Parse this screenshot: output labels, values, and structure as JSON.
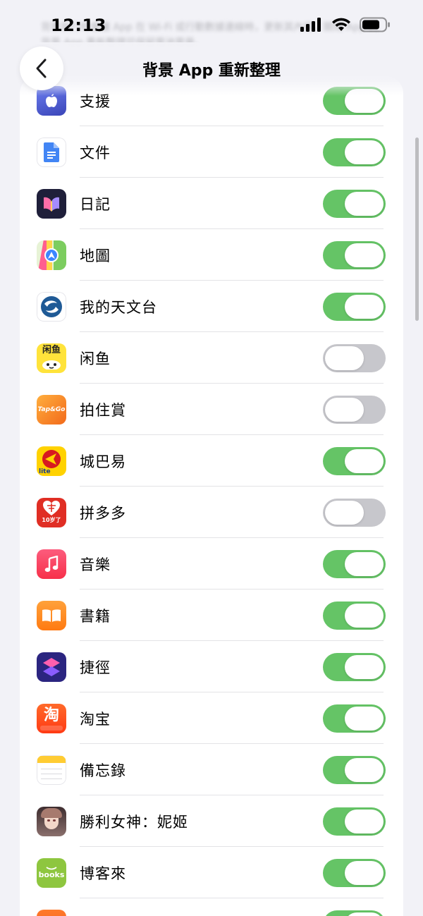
{
  "status": {
    "time": "12:13"
  },
  "nav": {
    "title": "背景 App 重新整理"
  },
  "header_hint": "背景執行時會讓 App 在 Wi-Fi 或行動數據連線時，更新其內容。關閉 App 的背景 App 重新整理可保留電池電量。",
  "apps": [
    {
      "name": "支援",
      "on": true,
      "icon": "apple-support-icon",
      "color": "#4a5bd6"
    },
    {
      "name": "文件",
      "on": true,
      "icon": "google-docs-icon",
      "color": "#ffffff"
    },
    {
      "name": "日記",
      "on": true,
      "icon": "journal-icon",
      "color": "#2c2c4a"
    },
    {
      "name": "地圖",
      "on": true,
      "icon": "maps-icon",
      "color": "#d6f0c8"
    },
    {
      "name": "我的天文台",
      "on": true,
      "icon": "observatory-icon",
      "color": "#ffffff"
    },
    {
      "name": "闲鱼",
      "on": false,
      "icon": "xianyu-icon",
      "color": "#ffe33b"
    },
    {
      "name": "拍住賞",
      "on": false,
      "icon": "tapngo-icon",
      "color": "#f7931e"
    },
    {
      "name": "城巴易",
      "on": true,
      "icon": "citybus-icon",
      "color": "#ffd200"
    },
    {
      "name": "拼多多",
      "on": false,
      "icon": "pinduoduo-icon",
      "color": "#e02e24"
    },
    {
      "name": "音樂",
      "on": true,
      "icon": "music-icon",
      "color": "#fa3b50"
    },
    {
      "name": "書籍",
      "on": true,
      "icon": "books-icon",
      "color": "#ff8a1e"
    },
    {
      "name": "捷徑",
      "on": true,
      "icon": "shortcuts-icon",
      "color": "#2e2a86"
    },
    {
      "name": "淘宝",
      "on": true,
      "icon": "taobao-icon",
      "color": "#ff4d1c"
    },
    {
      "name": "備忘錄",
      "on": true,
      "icon": "notes-icon",
      "color": "#ffffff"
    },
    {
      "name": "勝利女神：妮姬",
      "on": true,
      "icon": "nikke-icon",
      "color": "#6b5a58"
    },
    {
      "name": "博客來",
      "on": true,
      "icon": "bookscom-icon",
      "color": "#8ec63f"
    },
    {
      "name": "",
      "on": true,
      "icon": "partial-app-icon",
      "color": "#f26a2a"
    }
  ],
  "icon_text": {
    "xianyu": "闲鱼",
    "tapngo": "Tap&Go",
    "citybus": "lite",
    "pinduoduo": "10岁了",
    "taobao": "淘",
    "bookscom": "books"
  }
}
